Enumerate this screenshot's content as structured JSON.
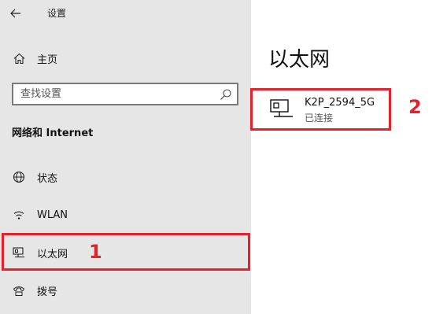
{
  "window": {
    "back_icon": "back-arrow-icon",
    "title": "设置"
  },
  "sidebar": {
    "home": {
      "label": "主页",
      "icon": "home-icon"
    },
    "search": {
      "placeholder": "查找设置",
      "icon": "search-icon"
    },
    "section_title": "网络和 Internet",
    "items": [
      {
        "label": "状态",
        "icon": "globe-icon"
      },
      {
        "label": "WLAN",
        "icon": "wifi-icon"
      },
      {
        "label": "以太网",
        "icon": "ethernet-icon",
        "selected": true
      },
      {
        "label": "拨号",
        "icon": "dialup-icon"
      }
    ]
  },
  "main": {
    "page_title": "以太网",
    "connection": {
      "name": "K2P_2594_5G",
      "status": "已连接",
      "icon": "ethernet-monitor-icon"
    }
  },
  "annotations": {
    "callout_1": "1",
    "callout_2": "2",
    "color": "#e8202a"
  }
}
